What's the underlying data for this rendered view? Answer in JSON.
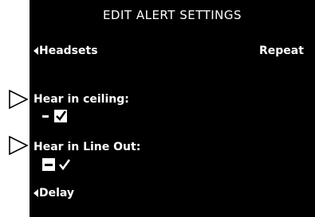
{
  "screen": {
    "title": "EDIT ALERT SETTINGS",
    "nav_left_label": "Headsets",
    "nav_right_label": "Repeat",
    "settings": [
      {
        "label": "Hear in ceiling:",
        "state": "on"
      },
      {
        "label": "Hear in Line Out:",
        "state": "off"
      }
    ],
    "bottom_nav_label": "Delay"
  },
  "icons": {
    "pointer": "pointer-arrow-icon",
    "nav_arrow": "nav-left-arrow-icon"
  },
  "colors": {
    "screen_bg": "#000000",
    "screen_fg": "#ffffff",
    "page_bg": "#ffffff"
  }
}
